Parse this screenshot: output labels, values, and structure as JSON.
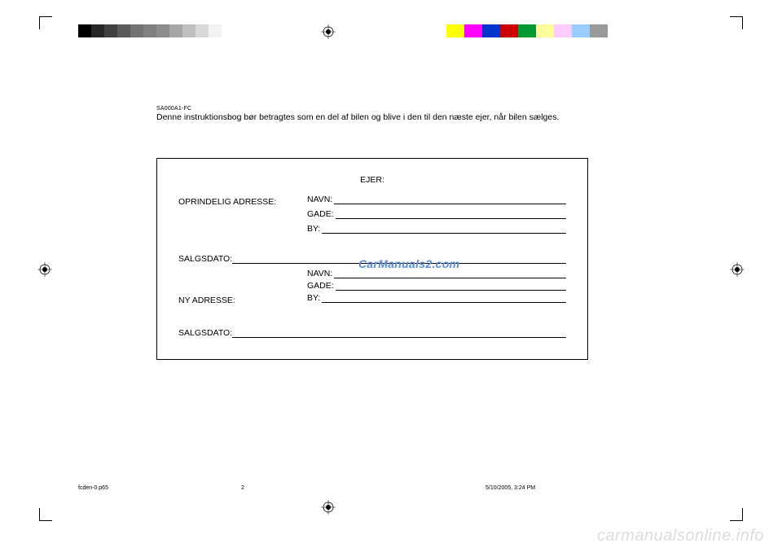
{
  "grayscale": [
    "#000000",
    "#262626",
    "#404040",
    "#595959",
    "#737373",
    "#808080",
    "#8c8c8c",
    "#a6a6a6",
    "#bfbfbf",
    "#d9d9d9",
    "#f2f2f2",
    "#ffffff"
  ],
  "color_swatches": [
    "#ffff00",
    "#ff00ff",
    "#0033cc",
    "#cc0000",
    "#009933",
    "#ffff99",
    "#ffccff",
    "#99ccff",
    "#999999"
  ],
  "doc_code": "SA000A1-FC",
  "instruction_text": "Denne instruktionsbog bør betragtes som en del af bilen og blive i den til den næste ejer, når bilen sælges.",
  "owner_box": {
    "header": "EJER:",
    "original_address_label": "OPRINDELIG ADRESSE:",
    "new_address_label": "NY ADRESSE:",
    "navn_label": "NAVN:",
    "gade_label": "GADE:",
    "by_label": "BY:",
    "salgsdato_label": "SALGSDATO:"
  },
  "watermark_center": "CarManuals2.com",
  "watermark_bottom": "carmanualsonline.info",
  "footer": {
    "filename": "fcden-0.p65",
    "page_number": "2",
    "timestamp": "5/10/2005, 3:24 PM"
  }
}
